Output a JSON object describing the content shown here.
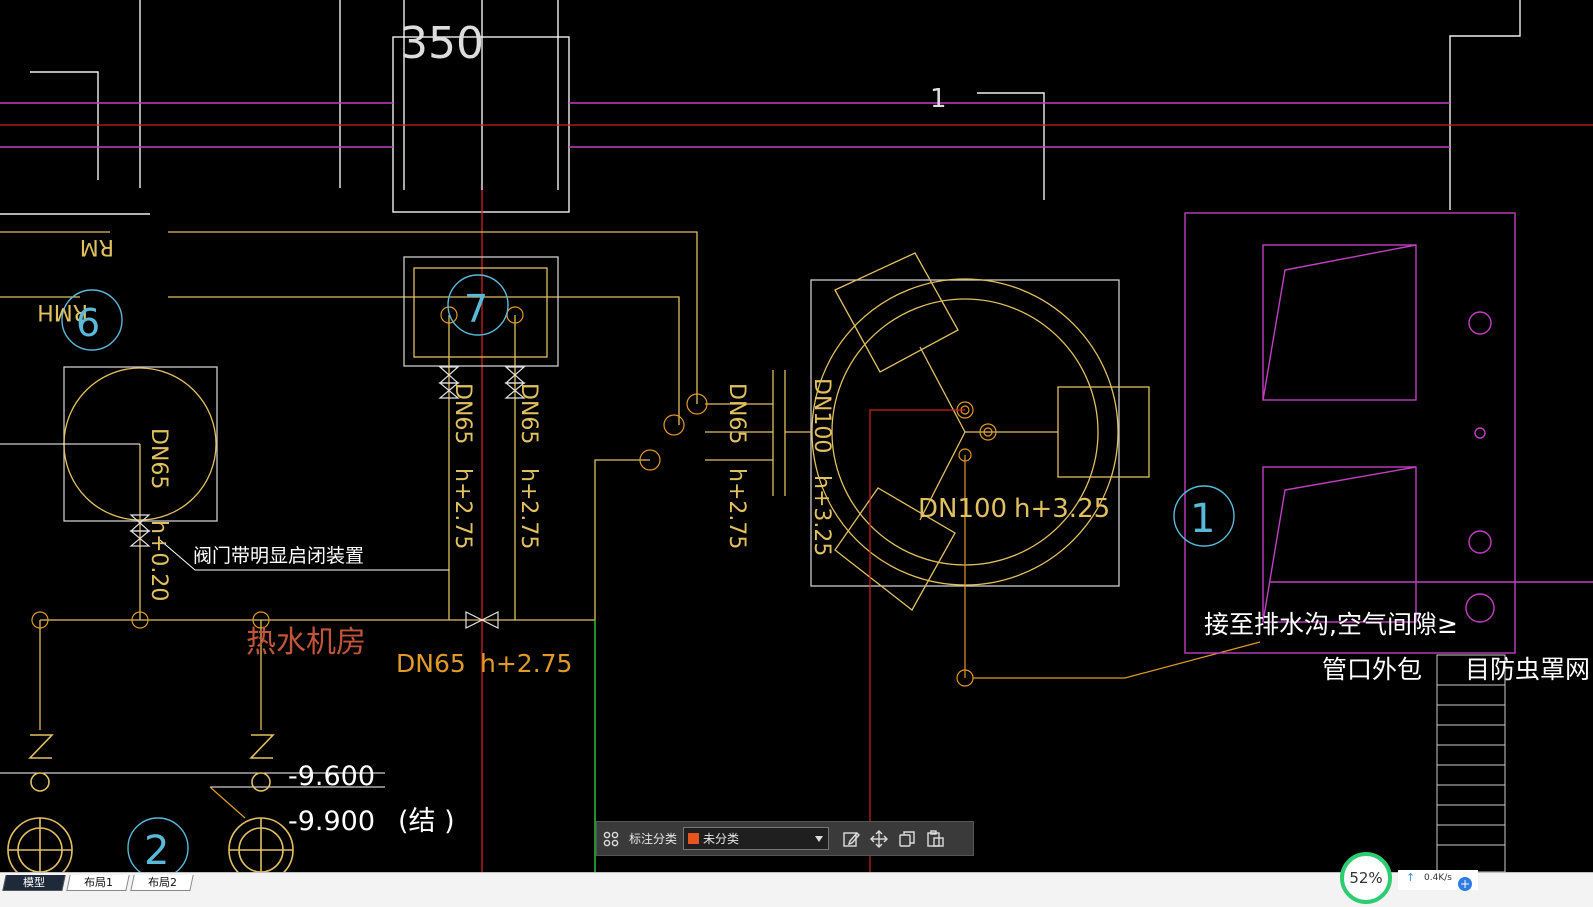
{
  "drawing": {
    "labels": {
      "dim_350": "350",
      "dim_1": "1",
      "rm": "RM",
      "rmh": "RMH",
      "node_6": "6",
      "node_7": "7",
      "node_1": "1",
      "node_2": "2",
      "dn65_a": "DN65",
      "h020": "h+0.20",
      "valve_note": "阀门带明显启闭装置",
      "dn65_b": "DN65",
      "h275_b": "h+2.75",
      "dn65_c": "DN65",
      "h275_c": "h+2.75",
      "dn65_d": "DN65",
      "h275_d": "h+2.75",
      "dn100_v": "DN100",
      "h325_v": "h+3.25",
      "dn100_h": "DN100",
      "h325_h": "h+3.25",
      "pump_room": "热水机房",
      "dn65_main": "DN65",
      "h275_main": "h+2.75",
      "drain_note_1": "接至排水沟,空气间隙≥",
      "drain_note_2": "管口外包",
      "insect_net": "目防虫罩网",
      "level_1": "-9.600",
      "level_2": "-9.900",
      "struct_note": "(结 )"
    }
  },
  "toolbar": {
    "label": "标注分类",
    "selected": "未分类",
    "icons": [
      "grid-icon",
      "edit-icon",
      "move-icon",
      "copy-icon",
      "paste-icon"
    ]
  },
  "tabs": {
    "model": "模型",
    "layout1": "布局1",
    "layout2": "布局2"
  },
  "status": {
    "zoom": "52%",
    "speed": "0.4K/s"
  },
  "colors": {
    "background": "#000000",
    "pipe_yellow": "#e0c060",
    "pipe_orange": "#e09a2a",
    "magenta": "#c040c0",
    "red": "#e02020",
    "cyan_circle": "#5ab8d8",
    "white_line": "#ffffff",
    "toolbar_bg": "#3a3a3a",
    "accent_swatch": "#e8541c"
  }
}
